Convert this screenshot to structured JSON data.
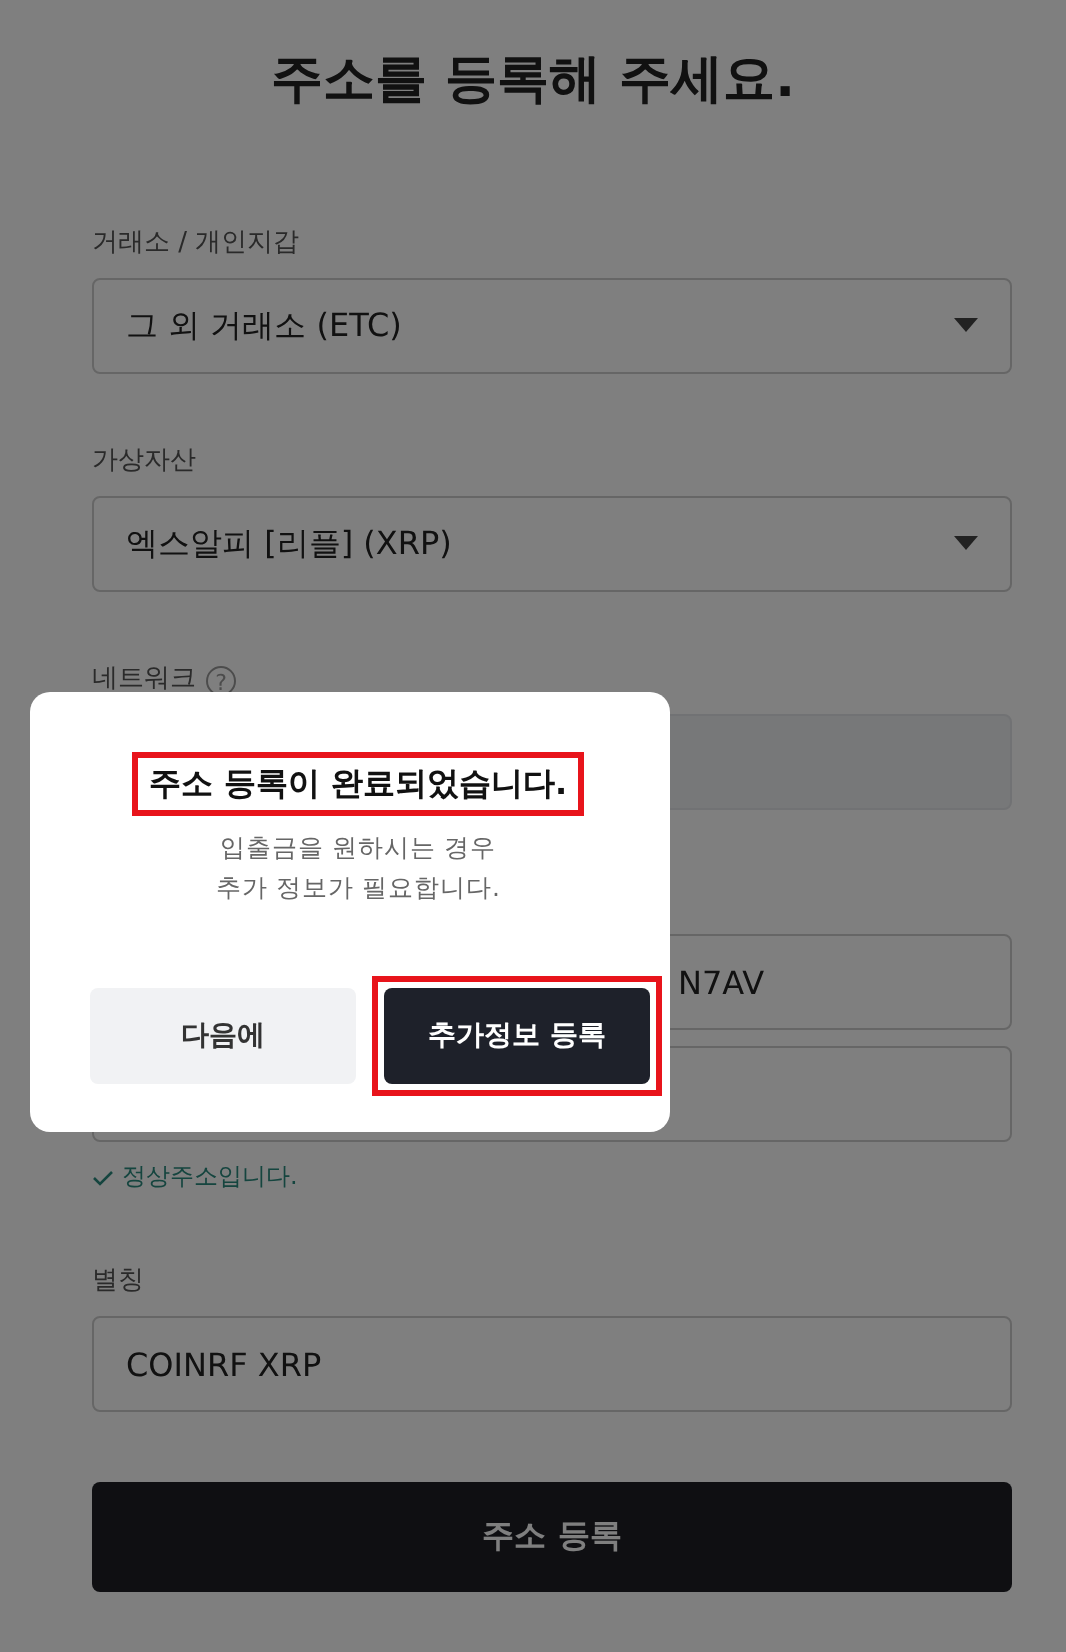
{
  "page": {
    "title": "주소를 등록해 주세요.",
    "fields": [
      {
        "kind": "select",
        "label": "거래소 / 개인지갑",
        "value": "그 외 거래소 (ETC)"
      },
      {
        "kind": "select",
        "label": "가상자산",
        "value": "엑스알피 [리플] (XRP)"
      },
      {
        "kind": "disabled",
        "label": "네트워크",
        "help": "?"
      },
      {
        "kind": "text",
        "value": "N7AV"
      },
      {
        "kind": "text",
        "valid_message": "정상주소입니다."
      },
      {
        "kind": "text",
        "label": "별칭",
        "value": "COINRF XRP"
      }
    ],
    "submit": "주소 등록"
  },
  "dialog": {
    "title": "주소 등록이 완료되었습니다.",
    "title_highlighted": true,
    "message": [
      "입출금을 원하시는 경우",
      "추가 정보가 필요합니다."
    ],
    "buttons": [
      {
        "label": "다음에",
        "kind": "secondary",
        "highlighted": false
      },
      {
        "label": "추가정보 등록",
        "kind": "primary",
        "highlighted": true
      }
    ]
  }
}
